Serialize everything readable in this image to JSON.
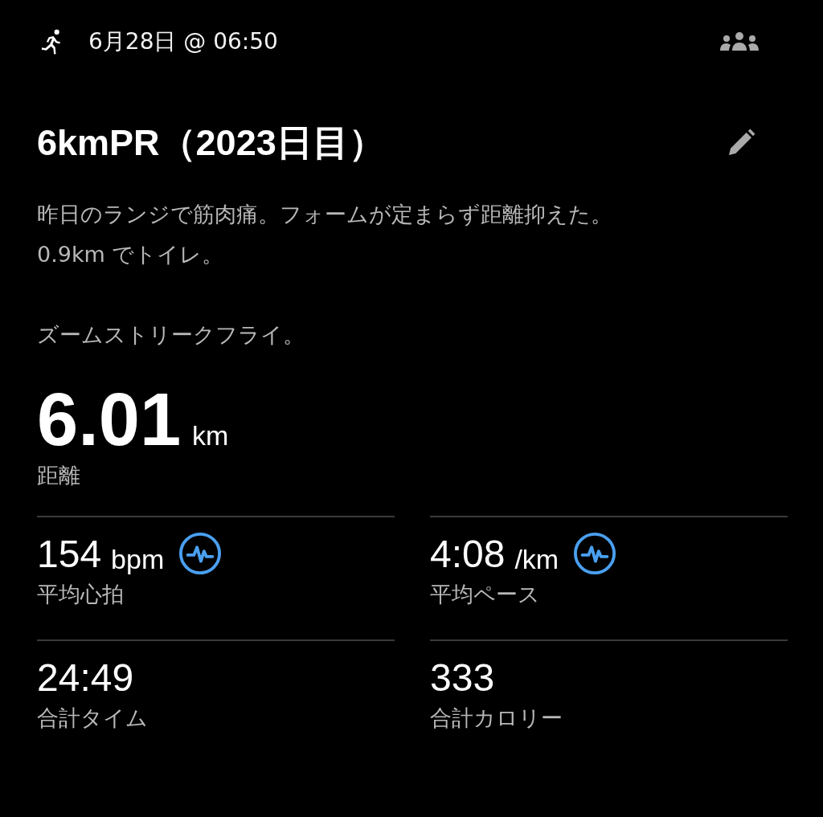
{
  "header": {
    "datetime": "6月28日 @ 06:50"
  },
  "title": "6kmPR（2023日目）",
  "description": [
    [
      "昨日のランジで筋肉痛。フォームが定まらず距離抑えた。",
      "0.9km でトイレ。"
    ],
    [
      "ズームストリークフライ。"
    ]
  ],
  "distance": {
    "value": "6.01",
    "unit": "km",
    "label": "距離"
  },
  "stats": [
    {
      "value": "154",
      "unit": "bpm",
      "label": "平均心拍",
      "heart_rate_badge": true
    },
    {
      "value": "4:08",
      "unit": "/km",
      "label": "平均ペース",
      "heart_rate_badge": true
    },
    {
      "value": "24:49",
      "label": "合計タイム",
      "heart_rate_badge": false
    },
    {
      "value": "333",
      "label": "合計カロリー",
      "heart_rate_badge": false
    }
  ]
}
